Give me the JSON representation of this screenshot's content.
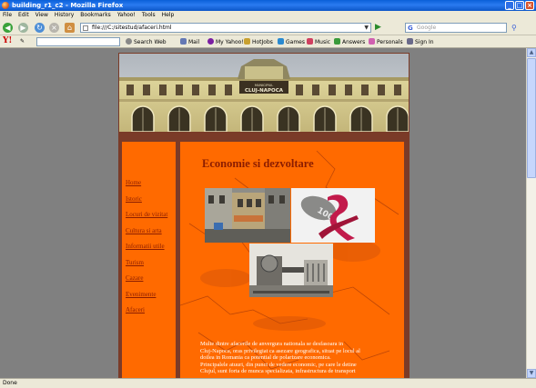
{
  "window": {
    "title": "building_r1_c2 - Mozilla Firefox",
    "controls": {
      "minimize": "_",
      "maximize": "□",
      "close": "×"
    }
  },
  "menu": [
    "File",
    "Edit",
    "View",
    "History",
    "Bookmarks",
    "Yahoo!",
    "Tools",
    "Help"
  ],
  "navigation": {
    "url": "file:///C:/sitestud/afaceri.html",
    "search_placeholder": "Google"
  },
  "yahoo_toolbar": {
    "logo": "Y!",
    "items": [
      "Search Web",
      "Mail",
      "My Yahoo!",
      "HotJobs",
      "Games",
      "Music",
      "Answers",
      "Personals",
      "Sign In"
    ]
  },
  "site": {
    "banner_sign": "CLUJ-NAPOCA",
    "banner_sign_top": "MUNICIPIUL",
    "nav_links": [
      "Home",
      "Istoric",
      "Locuri de vizitat",
      "Cultura si arta",
      "Informatii utile",
      "Turism",
      "Cazare",
      "Evenimente",
      "Afaceri"
    ],
    "heading": "Economie si dezvoltare",
    "paragraph_lines": [
      "Multe dintre afacerile de anvergura nationala se desfasoara in",
      "Cluj-Napoca, oras privilegiat ca asezare geografica, situat pe locul al",
      "doilea in Romania ca potential de polarizare economica.",
      "Principalele atuuri, din punct de vedere economic, pe care le detine",
      "Clujul, sunt forta de munca specializata, infrastructura de transport"
    ],
    "photo_labels": {
      "coins": "100"
    }
  },
  "status": "Done"
}
